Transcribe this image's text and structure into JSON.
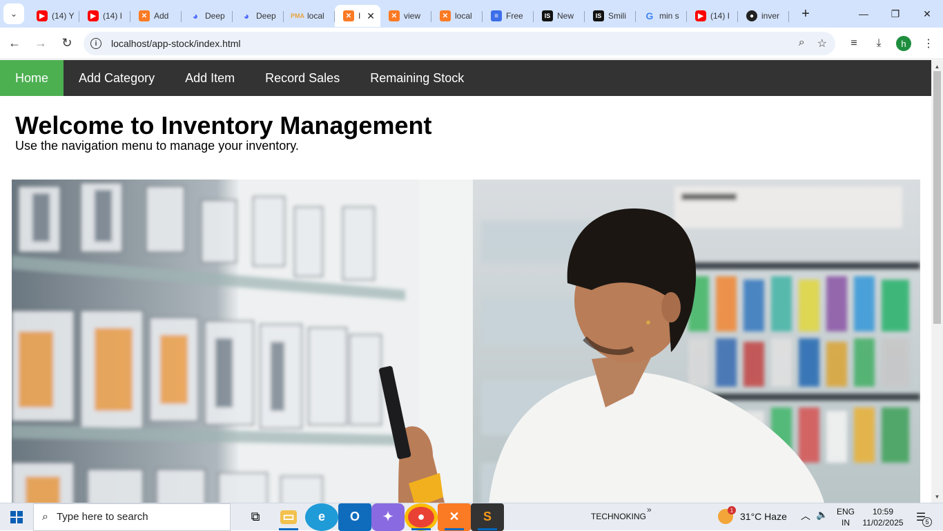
{
  "browser": {
    "tabs": [
      {
        "icon": "youtube-icon",
        "fav": "yt",
        "label": "(14) Y"
      },
      {
        "icon": "youtube-icon",
        "fav": "yt",
        "label": "(14) I"
      },
      {
        "icon": "xampp-icon",
        "fav": "xampp",
        "label": "Add"
      },
      {
        "icon": "deepseek-icon",
        "fav": "deep",
        "label": "Deep"
      },
      {
        "icon": "deepseek-icon",
        "fav": "deep",
        "label": "Deep"
      },
      {
        "icon": "phpmyadmin-icon",
        "fav": "pma",
        "label": "local"
      },
      {
        "icon": "xampp-icon",
        "fav": "xampp",
        "label": "I",
        "active": true
      },
      {
        "icon": "xampp-icon",
        "fav": "xampp",
        "label": "view"
      },
      {
        "icon": "xampp-icon",
        "fav": "xampp",
        "label": "local"
      },
      {
        "icon": "google-forms-icon",
        "fav": "forms",
        "label": "Free"
      },
      {
        "icon": "is-icon",
        "fav": "is",
        "label": "New"
      },
      {
        "icon": "is-icon",
        "fav": "is",
        "label": "Smili"
      },
      {
        "icon": "google-icon",
        "fav": "g",
        "label": "min s"
      },
      {
        "icon": "youtube-icon",
        "fav": "yt",
        "label": "(14) I"
      },
      {
        "icon": "github-icon",
        "fav": "gh",
        "label": "inver"
      }
    ],
    "url": "localhost/app-stock/index.html",
    "profile_initial": "h"
  },
  "page": {
    "nav": [
      "Home",
      "Add Category",
      "Add Item",
      "Record Sales",
      "Remaining Stock"
    ],
    "title": "Welcome to Inventory Management",
    "subtitle": "Use the navigation menu to manage your inventory."
  },
  "taskbar": {
    "search_placeholder": "Type here to search",
    "tray_label": "TECHNOKING",
    "weather": "31°C  Haze",
    "weather_badge": "1",
    "lang_top": "ENG",
    "lang_bottom": "IN",
    "time": "10:59",
    "date": "11/02/2025",
    "notifications": "5"
  },
  "colors": {
    "nav_bg": "#333333",
    "nav_active": "#4caf50"
  }
}
